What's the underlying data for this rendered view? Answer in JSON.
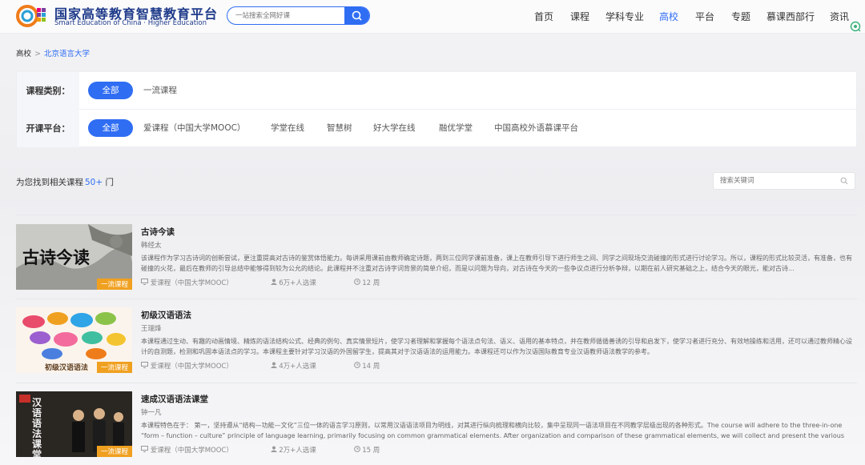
{
  "header": {
    "logo_cn": "国家高等教育智慧教育平台",
    "logo_en": "Smart Education of China · Higher Education",
    "search_placeholder": "一站搜索全网好课",
    "nav": [
      "首页",
      "课程",
      "学科专业",
      "高校",
      "平台",
      "专题",
      "慕课西部行",
      "资讯"
    ],
    "active_nav": "高校"
  },
  "breadcrumb": {
    "root": "高校",
    "separator": ">",
    "current": "北京语言大学"
  },
  "filters": {
    "category": {
      "label": "课程类别：",
      "options": [
        "全部",
        "一流课程"
      ]
    },
    "platform": {
      "label": "开课平台：",
      "options": [
        "全部",
        "爱课程（中国大学MOOC）",
        "学堂在线",
        "智慧树",
        "好大学在线",
        "融优学堂",
        "中国高校外语慕课平台"
      ]
    }
  },
  "result": {
    "prefix": "为您找到相关课程",
    "count": "50+",
    "suffix": "门",
    "search_placeholder": "搜索关键词"
  },
  "courses": [
    {
      "title": "古诗今读",
      "teacher": "韩经太",
      "badge": "一流课程",
      "thumb_text": "古诗今读",
      "desc": "该课程作为学习古诗词的创新尝试，更注重提高对古诗的鉴赏体悟能力。每讲采用课前由教师确定诗题，两到三位同学课前准备，课上在教师引导下进行师生之间、同学之间现场交流碰撞的形式进行讨论学习。所以，课程的形式比较灵活，有准备，也有碰撞的火花，最后在教师的引导总结中能够得到较为公允的结论。此课程并不注重对古诗字词背景的简单介绍，而是以问题为导向，对古诗在今天的一些争议点进行分析争辩，以期在前人研究基础之上，结合今天的眼光，能对古诗...",
      "platform": "爱课程（中国大学MOOC）",
      "students": "6万+人选课",
      "weeks": "12 周"
    },
    {
      "title": "初级汉语语法",
      "teacher": "王瑞烽",
      "badge": "一流课程",
      "thumb_text": "初级汉语语法",
      "desc": "本课程通过生动、有趣的动画情境、精炼的语法结构公式、经典的例句、真实情景短片，使学习者理解和掌握每个语法点句法、语义、语用的基本特点，并在教师循循善诱的引导和启发下，使学习者进行充分、有效地操练和活用，还可以通过教师精心设计的自测题，检测和巩固本语法点的学习。本课程主要针对学习汉语的外国留学生，提高其对于汉语语法的运用能力。本课程还可以作为汉语国际教育专业汉语教师语法教学的参考。",
      "platform": "爱课程（中国大学MOOC）",
      "students": "4万+人选课",
      "weeks": "14 周"
    },
    {
      "title": "速成汉语语法课堂",
      "teacher": "钟一凡",
      "badge": "一流课程",
      "thumb_text": "汉语语法课堂",
      "desc": "本课程特色在于： 第一，坚持遵从“结构—功能—文化”三位一体的语言学习原则，以常用汉语语法项目为明线，对其进行纵向梳理和横向比较，集中呈现同一语法项目在不同教学层级出现的各种形式。The course will adhere to the three-in-one “form – function – culture” principle of language learning, primarily focusing on common grammatical elements. After organization and comparison of these grammatical elements, we will collect and present the various forms in which a...",
      "platform": "爱课程（中国大学MOOC）",
      "students": "2万+人选课",
      "weeks": "15 周"
    }
  ],
  "colors": {
    "accent": "#2f6df3",
    "badge": "#f0a020",
    "logo": "#1f3b8a"
  }
}
